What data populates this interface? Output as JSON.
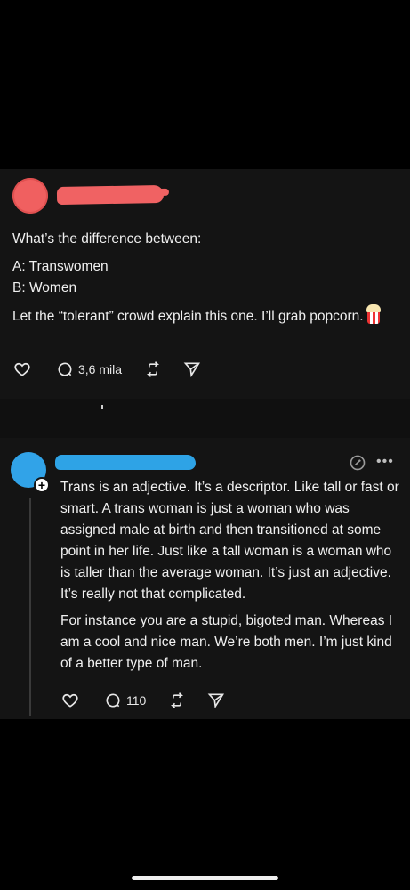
{
  "colors": {
    "background": "#000000",
    "card": "#141414",
    "text": "#f0f0f0",
    "redaction_red": "#f06263",
    "redaction_blue": "#2ea3e6"
  },
  "post": {
    "question": "What’s the difference between:",
    "option_a": "A: Transwomen",
    "option_b": "B: Women",
    "body": "Let the “tolerant” crowd explain this one. I’ll grab popcorn.",
    "emoji_icon": "popcorn-icon",
    "actions": {
      "like_icon": "heart-icon",
      "reply_icon": "comment-icon",
      "reply_count": "3,6 mila",
      "repost_icon": "repost-icon",
      "share_icon": "send-icon"
    }
  },
  "reply": {
    "paragraph1": "Trans is an adjective. It’s a descriptor. Like tall or fast or smart. A trans woman is just a woman who was assigned male at birth and then transitioned at some point in her life. Just like a tall woman is a woman who is taller than the average woman. It’s just an adjective. It’s really not that complicated.",
    "paragraph2": "For instance you are a stupid, bigoted man. Whereas I am a cool and nice man. We’re both men. I’m just kind of a better type of man.",
    "header_icons": [
      "edit-icon",
      "more-icon"
    ],
    "actions": {
      "like_icon": "heart-icon",
      "reply_icon": "comment-icon",
      "reply_count": "110",
      "repost_icon": "repost-icon",
      "share_icon": "send-icon"
    }
  }
}
